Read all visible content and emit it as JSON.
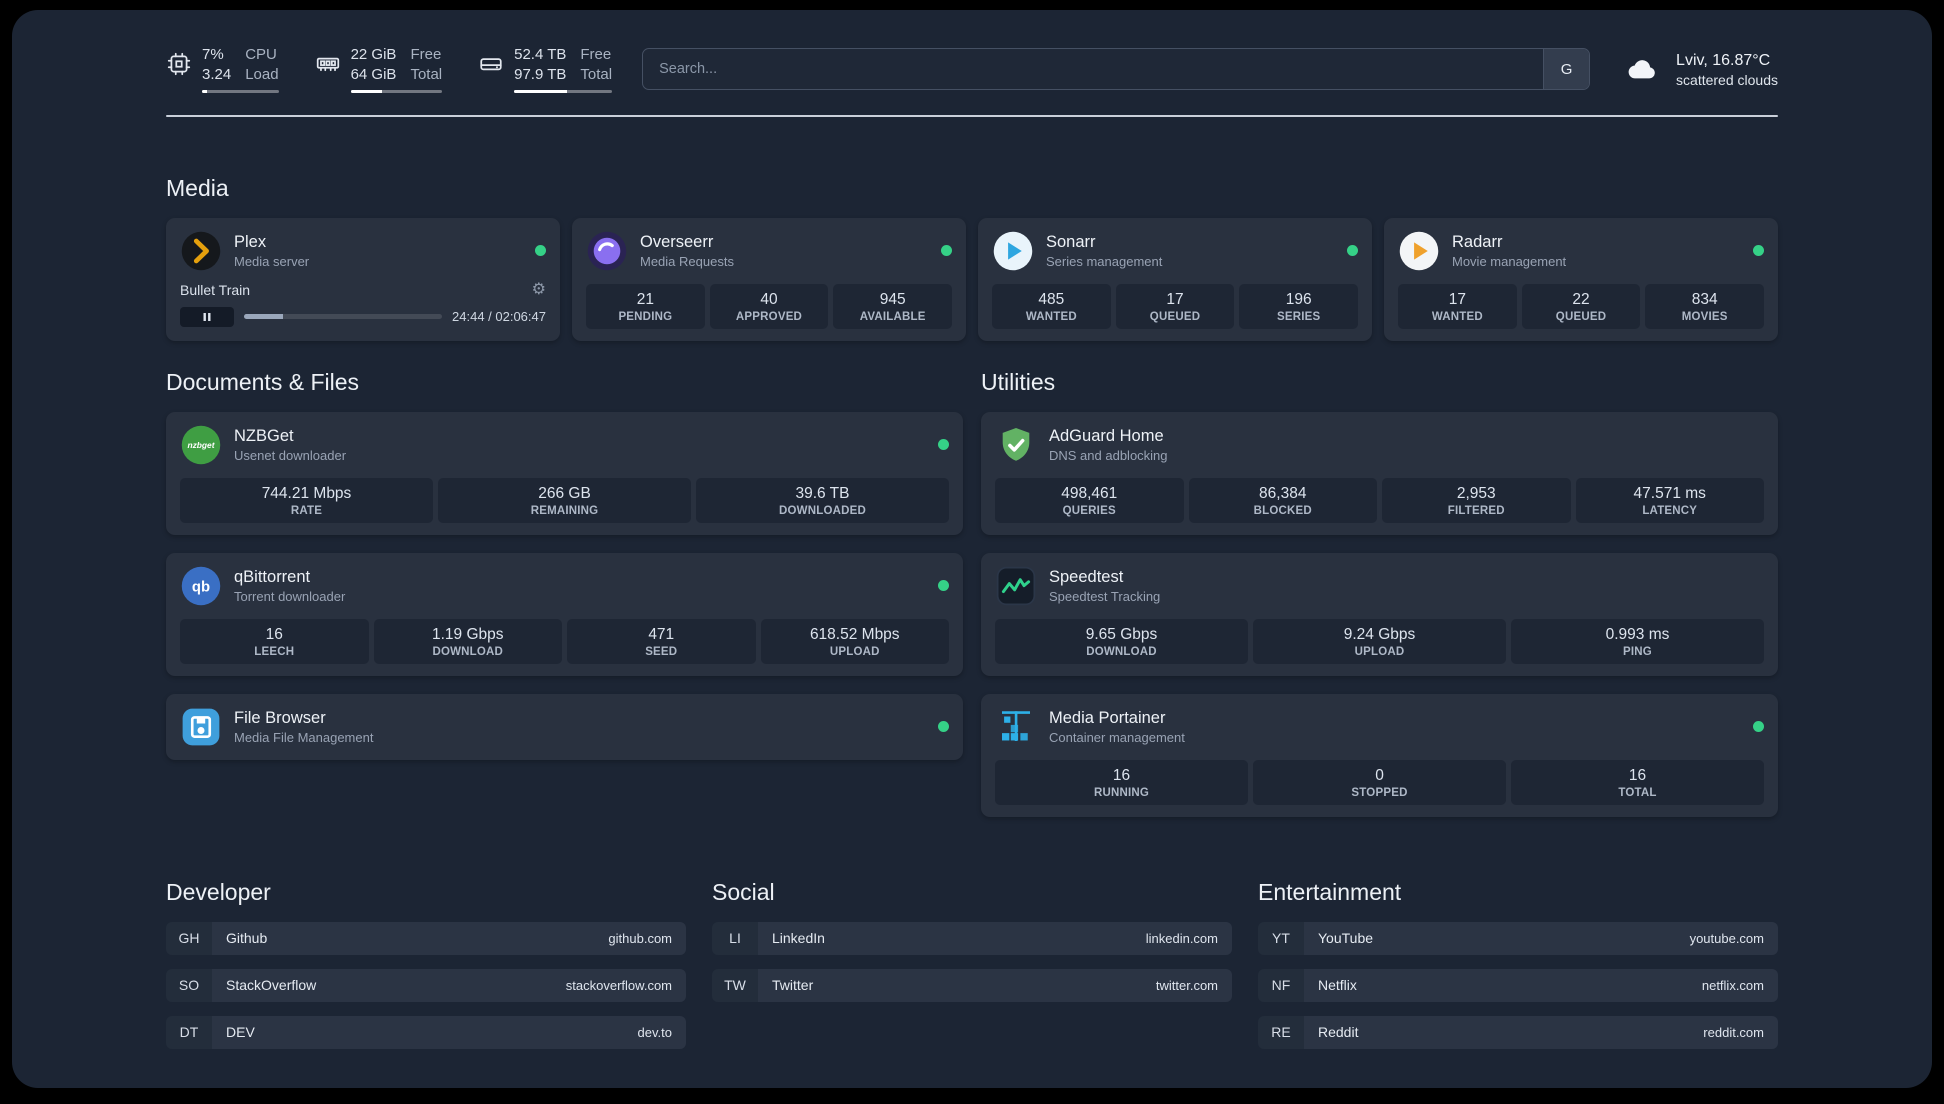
{
  "colors": {
    "status_online": "#35d187",
    "plex_amber": "#e5a00d",
    "accent_blue": "#2db0e8"
  },
  "topbar": {
    "cpu": {
      "value1": "7%",
      "label1": "CPU",
      "value2": "3.24",
      "label2": "Load",
      "bar": 0.07
    },
    "memory": {
      "value1": "22 GiB",
      "label1": "Free",
      "value2": "64 GiB",
      "label2": "Total",
      "bar": 0.34
    },
    "disk": {
      "value1": "52.4 TB",
      "label1": "Free",
      "value2": "97.9 TB",
      "label2": "Total",
      "bar": 0.54
    },
    "search": {
      "placeholder": "Search...",
      "provider": "G"
    },
    "weather": {
      "location": "Lviv, 16.87°C",
      "condition": "scattered clouds"
    }
  },
  "media": {
    "heading": "Media",
    "plex": {
      "name": "Plex",
      "desc": "Media server",
      "now_playing": {
        "title": "Bullet Train",
        "time": "24:44 / 02:06:47",
        "progress": 0.195,
        "state": "paused"
      }
    },
    "overseerr": {
      "name": "Overseerr",
      "desc": "Media Requests",
      "stats": [
        {
          "value": "21",
          "label": "PENDING"
        },
        {
          "value": "40",
          "label": "APPROVED"
        },
        {
          "value": "945",
          "label": "AVAILABLE"
        }
      ]
    },
    "sonarr": {
      "name": "Sonarr",
      "desc": "Series management",
      "stats": [
        {
          "value": "485",
          "label": "WANTED"
        },
        {
          "value": "17",
          "label": "QUEUED"
        },
        {
          "value": "196",
          "label": "SERIES"
        }
      ]
    },
    "radarr": {
      "name": "Radarr",
      "desc": "Movie management",
      "stats": [
        {
          "value": "17",
          "label": "WANTED"
        },
        {
          "value": "22",
          "label": "QUEUED"
        },
        {
          "value": "834",
          "label": "MOVIES"
        }
      ]
    }
  },
  "documents": {
    "heading": "Documents & Files",
    "nzbget": {
      "name": "NZBGet",
      "desc": "Usenet downloader",
      "stats": [
        {
          "value": "744.21 Mbps",
          "label": "RATE"
        },
        {
          "value": "266 GB",
          "label": "REMAINING"
        },
        {
          "value": "39.6 TB",
          "label": "DOWNLOADED"
        }
      ]
    },
    "qbittorrent": {
      "name": "qBittorrent",
      "desc": "Torrent downloader",
      "stats": [
        {
          "value": "16",
          "label": "LEECH"
        },
        {
          "value": "1.19 Gbps",
          "label": "DOWNLOAD"
        },
        {
          "value": "471",
          "label": "SEED"
        },
        {
          "value": "618.52 Mbps",
          "label": "UPLOAD"
        }
      ]
    },
    "filebrowser": {
      "name": "File Browser",
      "desc": "Media File Management"
    }
  },
  "utilities": {
    "heading": "Utilities",
    "adguard": {
      "name": "AdGuard Home",
      "desc": "DNS and adblocking",
      "stats": [
        {
          "value": "498,461",
          "label": "QUERIES"
        },
        {
          "value": "86,384",
          "label": "BLOCKED"
        },
        {
          "value": "2,953",
          "label": "FILTERED"
        },
        {
          "value": "47.571 ms",
          "label": "LATENCY"
        }
      ]
    },
    "speedtest": {
      "name": "Speedtest",
      "desc": "Speedtest Tracking",
      "stats": [
        {
          "value": "9.65 Gbps",
          "label": "DOWNLOAD"
        },
        {
          "value": "9.24 Gbps",
          "label": "UPLOAD"
        },
        {
          "value": "0.993 ms",
          "label": "PING"
        }
      ]
    },
    "portainer": {
      "name": "Media Portainer",
      "desc": "Container management",
      "stats": [
        {
          "value": "16",
          "label": "RUNNING"
        },
        {
          "value": "0",
          "label": "STOPPED"
        },
        {
          "value": "16",
          "label": "TOTAL"
        }
      ]
    }
  },
  "bookmarks": {
    "developer": {
      "heading": "Developer",
      "items": [
        {
          "abbr": "GH",
          "name": "Github",
          "domain": "github.com"
        },
        {
          "abbr": "SO",
          "name": "StackOverflow",
          "domain": "stackoverflow.com"
        },
        {
          "abbr": "DT",
          "name": "DEV",
          "domain": "dev.to"
        }
      ]
    },
    "social": {
      "heading": "Social",
      "items": [
        {
          "abbr": "LI",
          "name": "LinkedIn",
          "domain": "linkedin.com"
        },
        {
          "abbr": "TW",
          "name": "Twitter",
          "domain": "twitter.com"
        }
      ]
    },
    "entertainment": {
      "heading": "Entertainment",
      "items": [
        {
          "abbr": "YT",
          "name": "YouTube",
          "domain": "youtube.com"
        },
        {
          "abbr": "NF",
          "name": "Netflix",
          "domain": "netflix.com"
        },
        {
          "abbr": "RE",
          "name": "Reddit",
          "domain": "reddit.com"
        }
      ]
    }
  }
}
